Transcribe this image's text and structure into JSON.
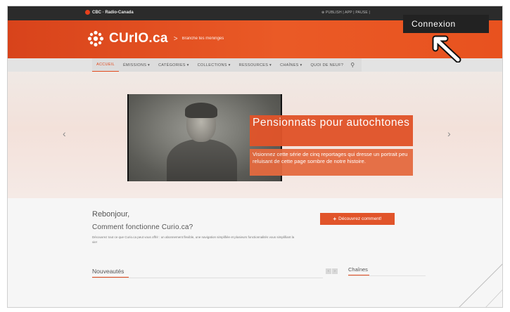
{
  "top_strip": {
    "logo_text": "CBC · Radio-Canada",
    "links": "⊕ PUBLISH | APP | PAUSE |"
  },
  "header": {
    "brand": "CUrIO.ca",
    "separator": ">",
    "tagline": "Branche tes méninges"
  },
  "overlay": {
    "connexion_label": "Connexion"
  },
  "nav": {
    "items": [
      {
        "label": "ACCUEIL"
      },
      {
        "label": "ÉMISSIONS ▾"
      },
      {
        "label": "CATÉGORIES ▾"
      },
      {
        "label": "COLLECTIONS ▾"
      },
      {
        "label": "RESSOURCES ▾"
      },
      {
        "label": "CHAÎNES ▾"
      },
      {
        "label": "QUOI DE NEUF?"
      }
    ],
    "search_icon": "⚲"
  },
  "hero": {
    "prev_label": "‹",
    "next_label": "›",
    "title": "Pensionnats pour autochtones",
    "description": "Visionnez cette série de cinq reportages qui dresse un portrait peu reluisant de cette page sombre de notre histoire."
  },
  "intro": {
    "greeting": "Rebonjour,",
    "question": "Comment fonctionne Curio.ca?",
    "description": "Découvrez tout ce que Curio.ca peut vous offrir : un abonnement flexible, une navigation simplifiée et plusieurs fonctionnalités vous simplifiant la vie!",
    "cta_label": "Découvrez comment!",
    "cta_icon": "+"
  },
  "sections": {
    "nouveautes": "Nouveautés",
    "chaines": "Chaînes",
    "prev_ctrl": "‹",
    "next_ctrl": "›"
  },
  "colors": {
    "brand": "#e1542a",
    "header_start": "#d8431b",
    "header_end": "#e8521f",
    "overlay": "#222222"
  }
}
